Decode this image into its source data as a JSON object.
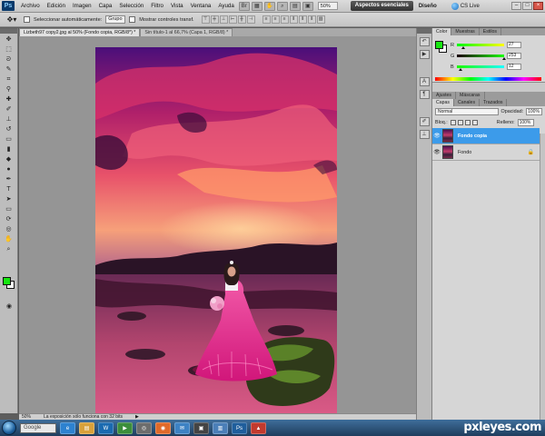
{
  "menubar": {
    "items": [
      "Archivo",
      "Edición",
      "Imagen",
      "Capa",
      "Selección",
      "Filtro",
      "Vista",
      "Ventana",
      "Ayuda"
    ],
    "zoom": "50%",
    "workspace": "Aspectos esenciales",
    "design": "Diseño",
    "cslive": "CS Live"
  },
  "options": {
    "auto_select": "Seleccionar automáticamente:",
    "group": "Grupo",
    "show_transform": "Mostrar controles transf."
  },
  "doc_tabs": [
    "Lizbeth97 copy2.jpg al 50% (Fondo copia, RGB/8*) *",
    "Sin título-1 al 66,7% (Capa 1, RGB/8) *"
  ],
  "status": {
    "zoom": "50%",
    "message": "La exposición sólo funciona con 32 bits"
  },
  "color_panel": {
    "tabs": [
      "Color",
      "Muestras",
      "Estilos"
    ],
    "fg_color": "#17e611",
    "bg_color": "#ffffff",
    "channels": [
      {
        "label": "R",
        "value": "27"
      },
      {
        "label": "G",
        "value": "253"
      },
      {
        "label": "B",
        "value": "12"
      }
    ]
  },
  "adjust_tabs": [
    "Ajustes",
    "Máscaras"
  ],
  "layers_panel": {
    "tabs": [
      "Capas",
      "Canales",
      "Trazados"
    ],
    "blend_mode": "Normal",
    "opacity_label": "Opacidad:",
    "opacity": "100%",
    "lock_label": "Bloq.:",
    "fill_label": "Relleno:",
    "fill": "100%",
    "layers": [
      {
        "name": "Fondo copia",
        "selected": true
      },
      {
        "name": "Fondo",
        "selected": false
      }
    ]
  },
  "taskbar": {
    "search": "Google"
  },
  "watermark": "pxleyes.com"
}
